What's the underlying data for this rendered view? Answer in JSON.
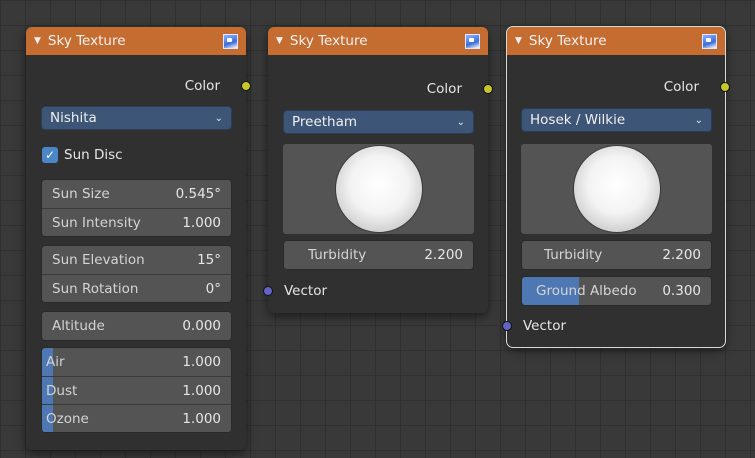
{
  "nodes": [
    {
      "title": "Sky Texture",
      "output": "Color",
      "type": "Nishita",
      "sun_disc": "Sun Disc",
      "sun_size": {
        "label": "Sun Size",
        "value": "0.545°"
      },
      "sun_intensity": {
        "label": "Sun Intensity",
        "value": "1.000"
      },
      "sun_elevation": {
        "label": "Sun Elevation",
        "value": "15°"
      },
      "sun_rotation": {
        "label": "Sun Rotation",
        "value": "0°"
      },
      "altitude": {
        "label": "Altitude",
        "value": "0.000"
      },
      "air": {
        "label": "Air",
        "value": "1.000",
        "fill": 0.06
      },
      "dust": {
        "label": "Dust",
        "value": "1.000",
        "fill": 0.06
      },
      "ozone": {
        "label": "Ozone",
        "value": "1.000",
        "fill": 0.06
      }
    },
    {
      "title": "Sky Texture",
      "output": "Color",
      "type": "Preetham",
      "turbidity": {
        "label": "Turbidity",
        "value": "2.200"
      },
      "input": "Vector"
    },
    {
      "title": "Sky Texture",
      "output": "Color",
      "type": "Hosek / Wilkie",
      "turbidity": {
        "label": "Turbidity",
        "value": "2.200"
      },
      "ground_albedo": {
        "label": "Ground Albedo",
        "value": "0.300",
        "fill": 0.3
      },
      "input": "Vector"
    }
  ],
  "colors": {
    "header": "#c56d30",
    "color_socket": "#c7c729",
    "vector_socket": "#6363c7",
    "dropdown": "#3d5576",
    "slider_fill": "#4d78b4"
  },
  "icons": {
    "collapse": "triangle-down",
    "header_icon": "image-preview-icon",
    "dropdown": "chevron-down"
  }
}
